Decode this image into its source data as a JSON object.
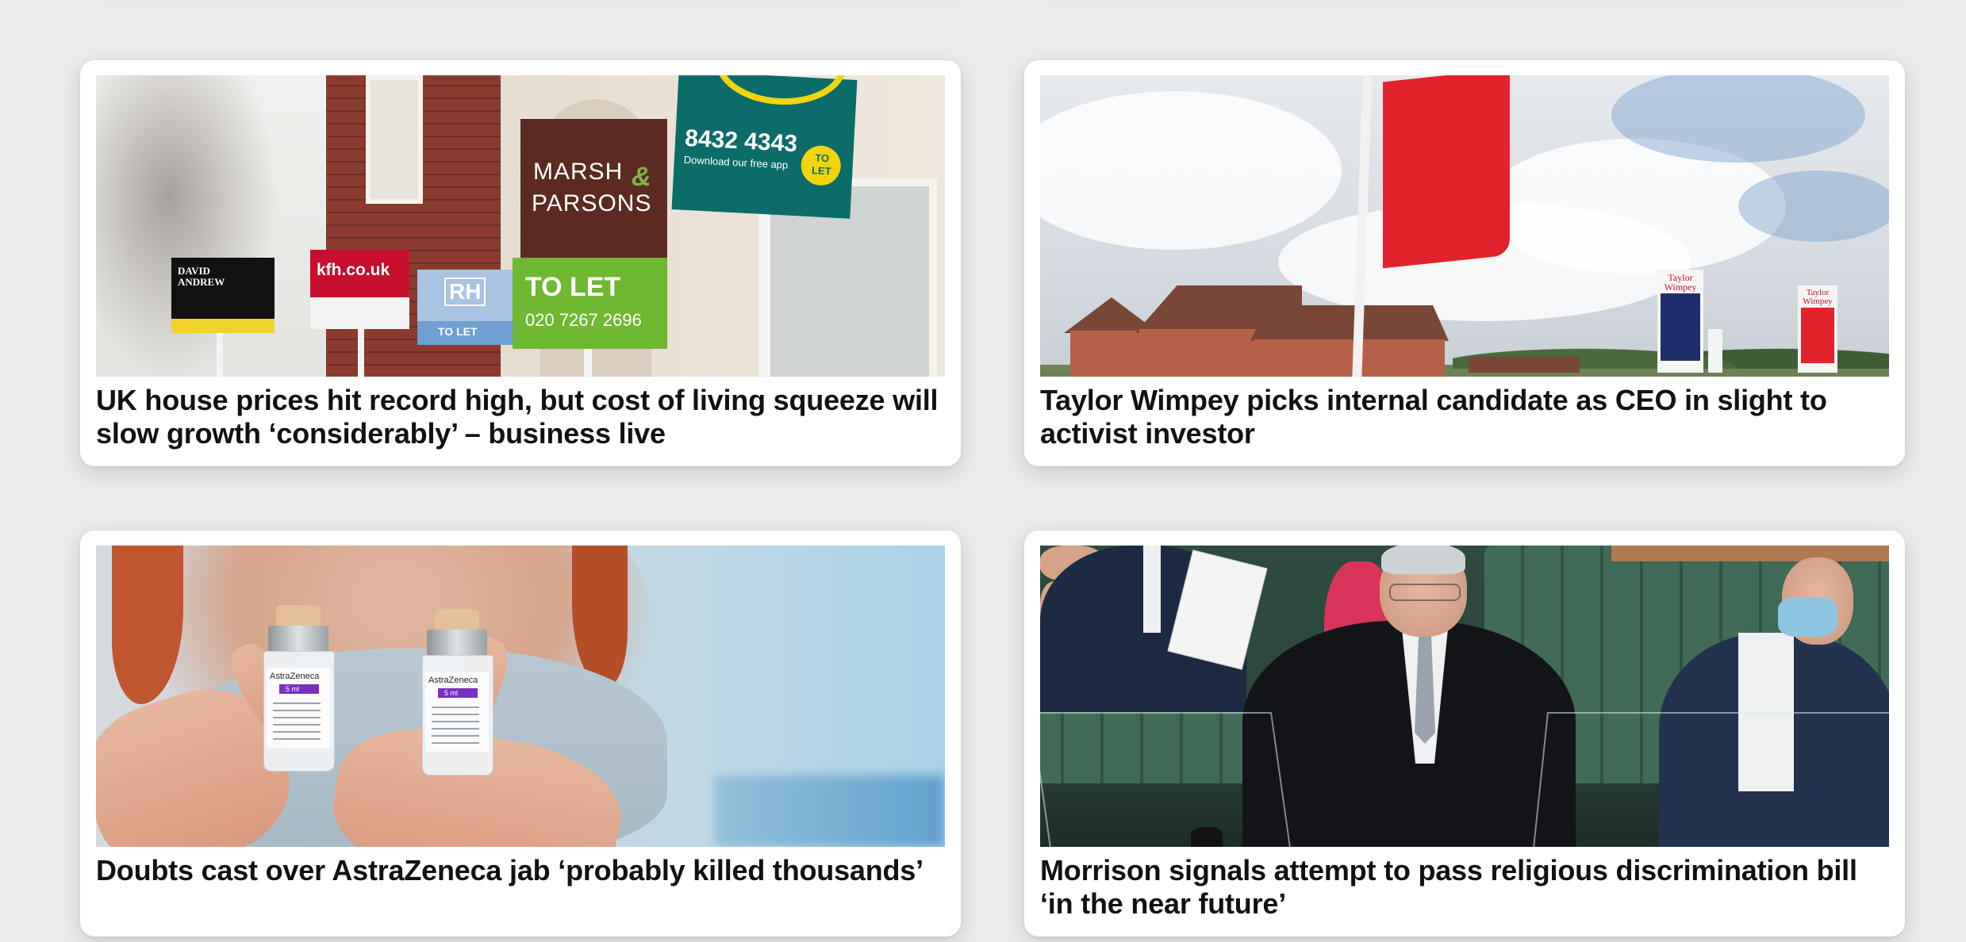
{
  "articles": [
    {
      "headline": "UK house prices hit record high, but cost of living squeeze will slow growth ‘considerably’ – business live",
      "image_description": "to-let boards outside terraced houses",
      "boards": {
        "mp_line1": "MARSH",
        "mp_amp": "&",
        "mp_line2": "PARSONS",
        "to_let": "TO LET",
        "phone": "020 7267 2696",
        "teal_number": "8432 4343",
        "teal_sub": "Download our free app",
        "teal_to_let": "TO LET",
        "kfh": "kfh.co.uk",
        "rh": "RH",
        "blue_to_let": "TO LET",
        "da": "DAVID ANDREW"
      }
    },
    {
      "headline": "Taylor Wimpey picks internal candidate as CEO in slight to activist investor",
      "image_description": "red flag and Taylor Wimpey banners over new-build houses",
      "banner_text": "Taylor Wimpey"
    },
    {
      "headline": "Doubts cast over AstraZeneca jab ‘probably killed thousands’",
      "image_description": "person in mask holding two AstraZeneca vaccine vials",
      "vial_label": "AstraZeneca",
      "vial_dose": "5 ml"
    },
    {
      "headline": "Morrison signals attempt to pass religious discrimination bill ‘in the near future’",
      "image_description": "Scott Morrison holding a document in parliament chamber"
    }
  ],
  "colors": {
    "page_background": "#ececec",
    "card_background": "#ffffff",
    "headline_text": "#111111"
  }
}
